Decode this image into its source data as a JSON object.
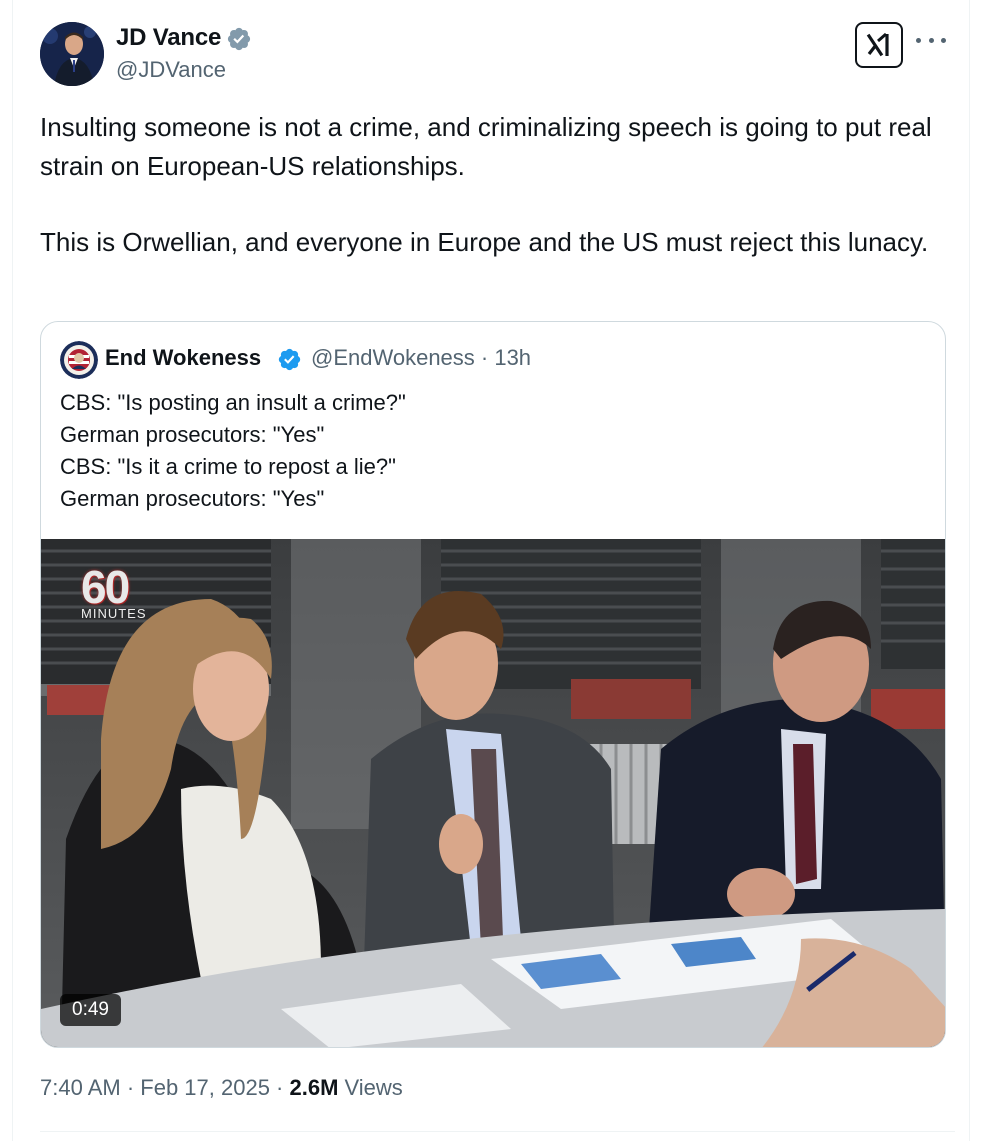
{
  "author": {
    "name": "JD Vance",
    "handle": "@JDVance",
    "verified_badge_icon": "verified-badge-icon",
    "badge_color": "#829aab"
  },
  "actions": {
    "grok_icon": "grok-icon",
    "more_icon": "more-options-icon"
  },
  "tweet": {
    "paragraph_1": "Insulting someone is not a crime, and criminalizing speech is going to put real strain on European-US relationships.",
    "paragraph_2": "This is Orwellian, and everyone in Europe and the US must reject this lunacy."
  },
  "quoted": {
    "name": "End Wokeness",
    "handle_time": "@EndWokeness · 13h",
    "badge_color": "#1d9bf0",
    "lines": [
      "CBS: \"Is posting an insult a crime?\"",
      "German prosecutors: \"Yes\"",
      "CBS: \"Is it a crime to repost a lie?\"",
      "German prosecutors: \"Yes\""
    ],
    "video": {
      "logo_number": "60",
      "logo_word": "MINUTES",
      "duration": "0:49"
    }
  },
  "meta": {
    "time": "7:40 AM · Feb 17, 2025 · ",
    "views_count": "2.6M",
    "views_label": " Views"
  }
}
